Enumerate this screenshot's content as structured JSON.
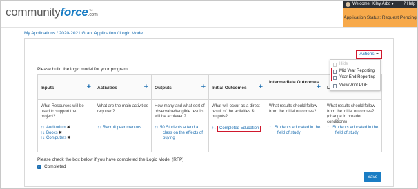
{
  "header": {
    "logo_part1": "community",
    "logo_part2": "force",
    "logo_part3": ".com",
    "logo_tm": "TM",
    "welcome": "Welcome, Kiley Arbo ▾",
    "help": "? Help",
    "status": "Application Status: Request Pending"
  },
  "breadcrumb": {
    "items": [
      "My Applications",
      "2020-2021 Grant Application",
      "Logic Model"
    ],
    "separator": " / "
  },
  "actions": {
    "label": "Actions",
    "menu": {
      "disabled_item": "Hide",
      "items": [
        "Mid Year Reporting",
        "Year End Reporting",
        "View/Print PDF"
      ]
    }
  },
  "instruction": "Please build the logic model for your program.",
  "columns": [
    {
      "title": "Inputs",
      "question": "What Resources will be used to support the project?",
      "items": [
        "Auditorium",
        "Books",
        "Computers"
      ]
    },
    {
      "title": "Activities",
      "question": "What are the main activities required?",
      "items": [
        "Recruit peer mentors"
      ]
    },
    {
      "title": "Outputs",
      "question": "How many and what sort of observable/tangible results will be achieved?",
      "items": [
        "50 Students attend a class on the effects of buying"
      ]
    },
    {
      "title": "Initial Outcomes",
      "question": "What will occur as a direct result of the activities & outputs?",
      "items": [
        "Completed Education"
      ]
    },
    {
      "title": "Intermediate Outcomes",
      "question": "What results should follow from the initial outcomes?",
      "items": [
        "Students educated in the field of study"
      ]
    },
    {
      "title": "Lo",
      "question": "What results should follow from the initial outcomes? (change in broader conditions)",
      "items": [
        "Students educated in the field of study"
      ]
    }
  ],
  "completion": {
    "note": "Please check the box below if you have completed the Logic Model (RFP)",
    "checkbox_label": "Completed",
    "checked": true
  },
  "save_label": "Save",
  "icons": {
    "plus": "+",
    "reorder": "↑↓",
    "remove": "✖",
    "check": "✓"
  },
  "colors": {
    "accent": "#1a7dc4",
    "status_bg": "#f7a94a",
    "highlight": "#d0182d",
    "topbar": "#2e3136"
  }
}
